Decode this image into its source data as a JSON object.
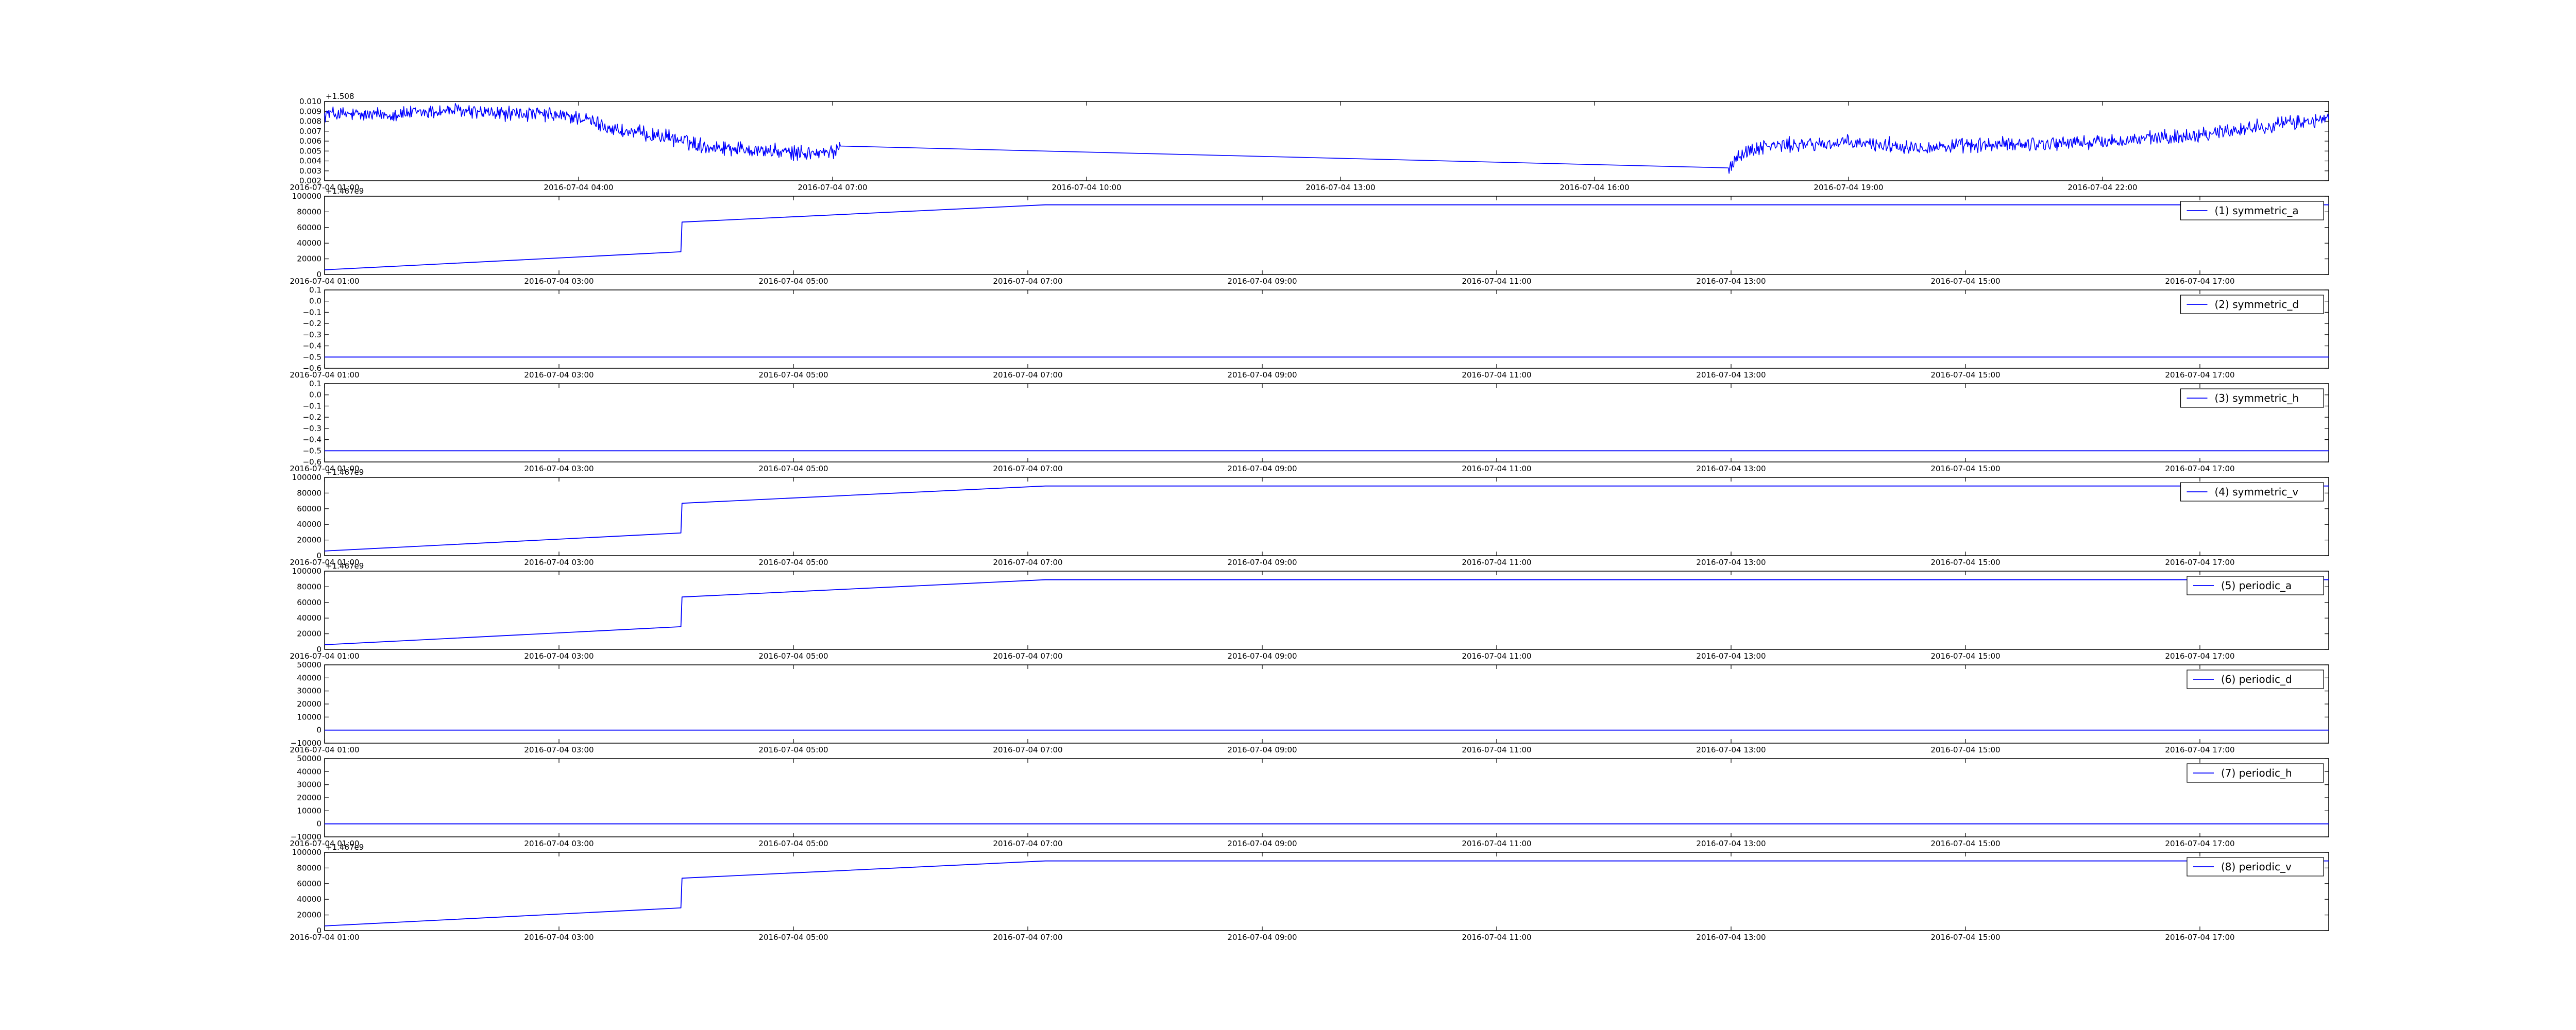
{
  "chart_data": [
    {
      "type": "line",
      "x_ticks": [
        "2016-07-04 01:00",
        "2016-07-04 04:00",
        "2016-07-04 07:00",
        "2016-07-04 10:00",
        "2016-07-04 13:00",
        "2016-07-04 16:00",
        "2016-07-04 19:00",
        "2016-07-04 22:00"
      ],
      "y_ticks": [
        "0.002",
        "0.003",
        "0.004",
        "0.005",
        "0.006",
        "0.007",
        "0.008",
        "0.009",
        "0.010"
      ],
      "y_offset": "+1.508",
      "ylim": [
        0.002,
        0.01
      ],
      "xlim_hours": [
        0.0,
        23.7
      ],
      "line_color": "#0000ff",
      "noisy": true,
      "series": [
        {
          "x": [
            0.0,
            0.5,
            1.0,
            1.5,
            2.0,
            2.5,
            3.0,
            3.25,
            3.5,
            4.0,
            4.5,
            5.0,
            5.5,
            6.0,
            6.1,
            16.6,
            16.7,
            17.0,
            18.0,
            19.0,
            20.0,
            21.0,
            22.0,
            23.0,
            23.7
          ],
          "y": [
            0.0088,
            0.0086,
            0.0088,
            0.0091,
            0.0088,
            0.0087,
            0.0084,
            0.0077,
            0.007,
            0.0065,
            0.0055,
            0.0052,
            0.0048,
            0.0048,
            0.0055,
            0.0033,
            0.0045,
            0.0055,
            0.0058,
            0.0054,
            0.0057,
            0.0059,
            0.0065,
            0.0076,
            0.0082
          ]
        }
      ]
    },
    {
      "type": "line",
      "x_ticks": [
        "2016-07-04 01:00",
        "2016-07-04 03:00",
        "2016-07-04 05:00",
        "2016-07-04 07:00",
        "2016-07-04 09:00",
        "2016-07-04 11:00",
        "2016-07-04 13:00",
        "2016-07-04 15:00",
        "2016-07-04 17:00"
      ],
      "y_ticks": [
        "0",
        "20000",
        "40000",
        "60000",
        "80000",
        "100000"
      ],
      "y_offset": "+1.467e9",
      "ylim": [
        0,
        100000
      ],
      "xlim_hours": [
        0.0,
        17.1
      ],
      "line_color": "#0000ff",
      "series": [
        {
          "name": "(1) symmetric_a",
          "x": [
            0.0,
            3.04,
            3.05,
            6.15,
            17.1
          ],
          "y": [
            6000,
            29000,
            67000,
            89000,
            89000
          ]
        }
      ]
    },
    {
      "type": "line",
      "x_ticks": [
        "2016-07-04 01:00",
        "2016-07-04 03:00",
        "2016-07-04 05:00",
        "2016-07-04 07:00",
        "2016-07-04 09:00",
        "2016-07-04 11:00",
        "2016-07-04 13:00",
        "2016-07-04 15:00",
        "2016-07-04 17:00"
      ],
      "y_ticks": [
        "−0.6",
        "−0.5",
        "−0.4",
        "−0.3",
        "−0.2",
        "−0.1",
        "0.0",
        "0.1"
      ],
      "y_offset": "",
      "ylim": [
        -0.6,
        0.1
      ],
      "xlim_hours": [
        0.0,
        17.1
      ],
      "line_color": "#0000ff",
      "series": [
        {
          "name": "(2) symmetric_d",
          "x": [
            0.0,
            17.1
          ],
          "y": [
            -0.5,
            -0.5
          ]
        }
      ]
    },
    {
      "type": "line",
      "x_ticks": [
        "2016-07-04 01:00",
        "2016-07-04 03:00",
        "2016-07-04 05:00",
        "2016-07-04 07:00",
        "2016-07-04 09:00",
        "2016-07-04 11:00",
        "2016-07-04 13:00",
        "2016-07-04 15:00",
        "2016-07-04 17:00"
      ],
      "y_ticks": [
        "−0.6",
        "−0.5",
        "−0.4",
        "−0.3",
        "−0.2",
        "−0.1",
        "0.0",
        "0.1"
      ],
      "y_offset": "",
      "ylim": [
        -0.6,
        0.1
      ],
      "xlim_hours": [
        0.0,
        17.1
      ],
      "line_color": "#0000ff",
      "series": [
        {
          "name": "(3) symmetric_h",
          "x": [
            0.0,
            17.1
          ],
          "y": [
            -0.5,
            -0.5
          ]
        }
      ]
    },
    {
      "type": "line",
      "x_ticks": [
        "2016-07-04 01:00",
        "2016-07-04 03:00",
        "2016-07-04 05:00",
        "2016-07-04 07:00",
        "2016-07-04 09:00",
        "2016-07-04 11:00",
        "2016-07-04 13:00",
        "2016-07-04 15:00",
        "2016-07-04 17:00"
      ],
      "y_ticks": [
        "0",
        "20000",
        "40000",
        "60000",
        "80000",
        "100000"
      ],
      "y_offset": "+1.467e9",
      "ylim": [
        0,
        100000
      ],
      "xlim_hours": [
        0.0,
        17.1
      ],
      "line_color": "#0000ff",
      "series": [
        {
          "name": "(4) symmetric_v",
          "x": [
            0.0,
            3.04,
            3.05,
            6.15,
            17.1
          ],
          "y": [
            6000,
            29000,
            67000,
            89000,
            89000
          ]
        }
      ]
    },
    {
      "type": "line",
      "x_ticks": [
        "2016-07-04 01:00",
        "2016-07-04 03:00",
        "2016-07-04 05:00",
        "2016-07-04 07:00",
        "2016-07-04 09:00",
        "2016-07-04 11:00",
        "2016-07-04 13:00",
        "2016-07-04 15:00",
        "2016-07-04 17:00"
      ],
      "y_ticks": [
        "0",
        "20000",
        "40000",
        "60000",
        "80000",
        "100000"
      ],
      "y_offset": "+1.467e9",
      "ylim": [
        0,
        100000
      ],
      "xlim_hours": [
        0.0,
        17.1
      ],
      "line_color": "#0000ff",
      "series": [
        {
          "name": "(5) periodic_a",
          "x": [
            0.0,
            3.04,
            3.05,
            6.15,
            17.1
          ],
          "y": [
            6000,
            29000,
            67000,
            89000,
            89000
          ]
        }
      ]
    },
    {
      "type": "line",
      "x_ticks": [
        "2016-07-04 01:00",
        "2016-07-04 03:00",
        "2016-07-04 05:00",
        "2016-07-04 07:00",
        "2016-07-04 09:00",
        "2016-07-04 11:00",
        "2016-07-04 13:00",
        "2016-07-04 15:00",
        "2016-07-04 17:00"
      ],
      "y_ticks": [
        "−10000",
        "0",
        "10000",
        "20000",
        "30000",
        "40000",
        "50000"
      ],
      "y_offset": "",
      "ylim": [
        -10000,
        50000
      ],
      "xlim_hours": [
        0.0,
        17.1
      ],
      "line_color": "#0000ff",
      "series": [
        {
          "name": "(6) periodic_d",
          "x": [
            0.0,
            17.1
          ],
          "y": [
            0,
            0
          ]
        }
      ]
    },
    {
      "type": "line",
      "x_ticks": [
        "2016-07-04 01:00",
        "2016-07-04 03:00",
        "2016-07-04 05:00",
        "2016-07-04 07:00",
        "2016-07-04 09:00",
        "2016-07-04 11:00",
        "2016-07-04 13:00",
        "2016-07-04 15:00",
        "2016-07-04 17:00"
      ],
      "y_ticks": [
        "−10000",
        "0",
        "10000",
        "20000",
        "30000",
        "40000",
        "50000"
      ],
      "y_offset": "",
      "ylim": [
        -10000,
        50000
      ],
      "xlim_hours": [
        0.0,
        17.1
      ],
      "line_color": "#0000ff",
      "series": [
        {
          "name": "(7) periodic_h",
          "x": [
            0.0,
            17.1
          ],
          "y": [
            0,
            0
          ]
        }
      ]
    },
    {
      "type": "line",
      "x_ticks": [
        "2016-07-04 01:00",
        "2016-07-04 03:00",
        "2016-07-04 05:00",
        "2016-07-04 07:00",
        "2016-07-04 09:00",
        "2016-07-04 11:00",
        "2016-07-04 13:00",
        "2016-07-04 15:00",
        "2016-07-04 17:00"
      ],
      "y_ticks": [
        "0",
        "20000",
        "40000",
        "60000",
        "80000",
        "100000"
      ],
      "y_offset": "+1.467e9",
      "ylim": [
        0,
        100000
      ],
      "xlim_hours": [
        0.0,
        17.1
      ],
      "line_color": "#0000ff",
      "series": [
        {
          "name": "(8) periodic_v",
          "x": [
            0.0,
            3.04,
            3.05,
            6.15,
            17.1
          ],
          "y": [
            6000,
            29000,
            67000,
            89000,
            89000
          ]
        }
      ]
    }
  ]
}
